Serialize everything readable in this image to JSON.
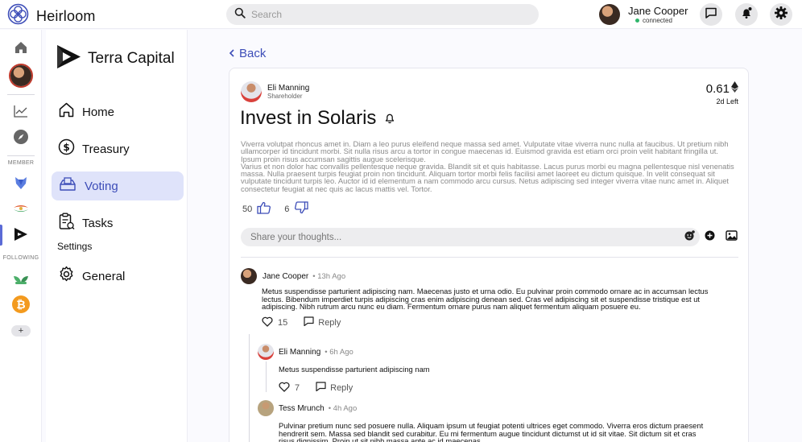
{
  "app": {
    "name": "Heirloom"
  },
  "search": {
    "placeholder": "Search"
  },
  "user": {
    "name": "Jane Cooper",
    "status": "connected"
  },
  "rail": {
    "member_label": "MEMBER",
    "following_label": "FOLLOWING",
    "add_label": "+"
  },
  "dao": {
    "name": "Terra Capital",
    "nav": [
      {
        "label": "Home",
        "icon": "home-icon"
      },
      {
        "label": "Treasury",
        "icon": "dollar-icon"
      },
      {
        "label": "Voting",
        "icon": "ballot-box-icon"
      },
      {
        "label": "Tasks",
        "icon": "clipboard-icon"
      }
    ],
    "settings_label": "Settings",
    "general_label": "General"
  },
  "main": {
    "back_label": "Back",
    "post": {
      "author": "Eli Manning",
      "role": "Shareholder",
      "price": "0.61",
      "time_left": "2d Left",
      "title": "Invest in Solaris",
      "body_1": "Viverra volutpat rhoncus amet in. Diam a leo purus eleifend neque massa sed amet. Vulputate vitae viverra nunc nulla at faucibus. Ut pretium nibh ullamcorper id tincidunt morbi. Sit nulla risus arcu a tortor in congue maecenas id. Euismod gravida est etiam orci proin velit habitant fringilla ut. Ipsum proin risus accumsan sagittis augue scelerisque.",
      "body_2": "Varius et non dolor hac convallis pellentesque neque gravida. Blandit sit et quis habitasse. Lacus purus morbi eu magna pellentesque nisl venenatis massa. Nulla praesent turpis feugiat proin non tincidunt. Aliquam tortor morbi felis facilisi amet laoreet eu dictum quisque. In velit consequat sit vulputate tincidunt turpis leo. Auctor id id elementum a nam commodo arcu cursus. Netus adipiscing sed integer viverra vitae nunc amet in. Aliquet consectetur feugiat at nec quis ac lacus mattis vel. Tortor.",
      "upvotes": "50",
      "downvotes": "6"
    },
    "share_placeholder": "Share your thoughts...",
    "comments": [
      {
        "name": "Jane Cooper",
        "time": "13h Ago",
        "text": "Metus suspendisse parturient adipiscing nam. Maecenas justo et urna odio. Eu pulvinar proin commodo ornare ac in accumsan lectus lectus. Bibendum imperdiet turpis adipiscing cras enim adipiscing denean sed. Cras vel adipiscing sit et suspendisse tristique est ut adipiscing. Nibh rutrum arcu nunc eu diam. Fermentum ornare purus nam aliquet fermentum aliquam posuere eu.",
        "likes": "15",
        "reply_label": "Reply"
      },
      {
        "name": "Eli Manning",
        "time": "6h Ago",
        "text": "Metus suspendisse parturient adipiscing nam",
        "likes": "7",
        "reply_label": "Reply"
      },
      {
        "name": "Tess Mrunch",
        "time": "4h Ago",
        "text": "Pulvinar pretium nunc sed posuere nulla. Aliquam ipsum ut feugiat potenti ultrices eget commodo. Viverra eros dictum praesent hendrerit sem. Massa sed blandit sed curabitur. Eu mi fermentum augue tincidunt dictumst ut id sit vitae. Sit dictum sit et cras risus dignissim. Proin ut sit nibh massa ante ac id maecenas."
      }
    ]
  }
}
